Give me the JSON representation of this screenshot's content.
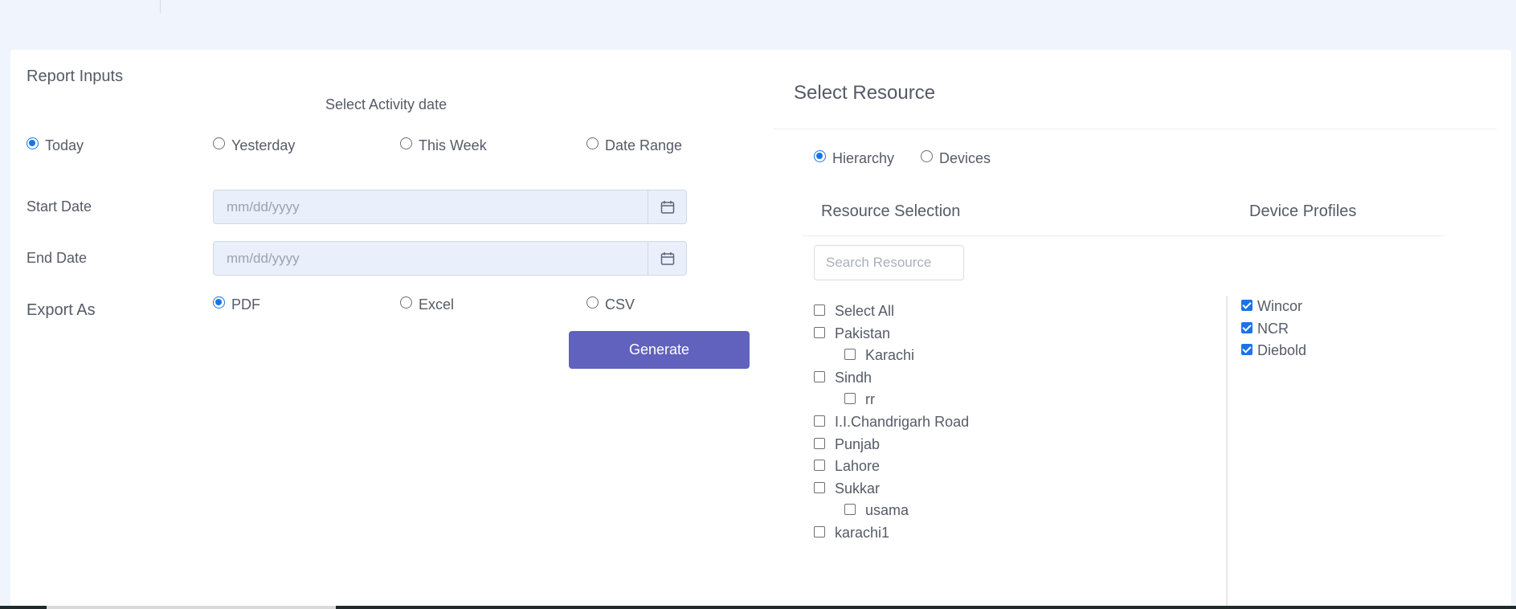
{
  "report": {
    "title": "Report Inputs",
    "activity_label": "Select Activity date",
    "date_options": [
      {
        "label": "Today",
        "checked": true
      },
      {
        "label": "Yesterday",
        "checked": false
      },
      {
        "label": "This Week",
        "checked": false
      },
      {
        "label": "Date Range",
        "checked": false
      }
    ],
    "start_label": "Start Date",
    "start_placeholder": "mm/dd/yyyy",
    "end_label": "End Date",
    "end_placeholder": "mm/dd/yyyy",
    "export_label": "Export As",
    "export_options": [
      {
        "label": "PDF",
        "checked": true
      },
      {
        "label": "Excel",
        "checked": false
      },
      {
        "label": "CSV",
        "checked": false
      }
    ],
    "generate_label": "Generate"
  },
  "resource": {
    "title": "Select Resource",
    "mode_options": [
      {
        "label": "Hierarchy",
        "checked": true
      },
      {
        "label": "Devices",
        "checked": false
      }
    ],
    "selection_heading": "Resource Selection",
    "profiles_heading": "Device Profiles",
    "search_placeholder": "Search Resource",
    "tree": [
      {
        "label": "Select All",
        "indent": 0
      },
      {
        "label": "Pakistan",
        "indent": 0
      },
      {
        "label": "Karachi",
        "indent": 1
      },
      {
        "label": "Sindh",
        "indent": 0
      },
      {
        "label": "rr",
        "indent": 1
      },
      {
        "label": "I.I.Chandrigarh Road",
        "indent": 0
      },
      {
        "label": "Punjab",
        "indent": 0
      },
      {
        "label": "Lahore",
        "indent": 0
      },
      {
        "label": "Sukkar",
        "indent": 0
      },
      {
        "label": "usama",
        "indent": 1
      },
      {
        "label": "karachi1",
        "indent": 0
      }
    ],
    "profiles": [
      {
        "label": "Wincor",
        "checked": true
      },
      {
        "label": "NCR",
        "checked": true
      },
      {
        "label": "Diebold",
        "checked": true
      }
    ]
  },
  "colors": {
    "accent": "#1a73e8",
    "button": "#6162bd",
    "page_bg": "#f0f5fd"
  }
}
